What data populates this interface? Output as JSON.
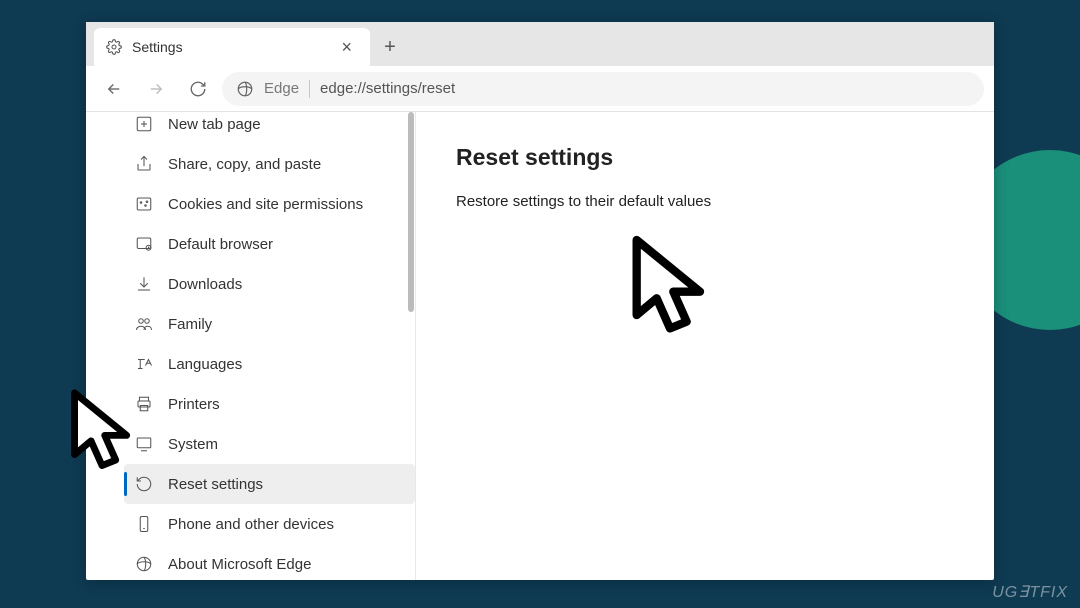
{
  "tab": {
    "title": "Settings"
  },
  "toolbar": {
    "edge_label": "Edge",
    "url": "edge://settings/reset"
  },
  "sidebar": {
    "items": [
      {
        "label": "New tab page",
        "icon": "newtab"
      },
      {
        "label": "Share, copy, and paste",
        "icon": "share"
      },
      {
        "label": "Cookies and site permissions",
        "icon": "cookies"
      },
      {
        "label": "Default browser",
        "icon": "defaultbrowser"
      },
      {
        "label": "Downloads",
        "icon": "downloads"
      },
      {
        "label": "Family",
        "icon": "family"
      },
      {
        "label": "Languages",
        "icon": "languages"
      },
      {
        "label": "Printers",
        "icon": "printers"
      },
      {
        "label": "System",
        "icon": "system"
      },
      {
        "label": "Reset settings",
        "icon": "reset",
        "active": true
      },
      {
        "label": "Phone and other devices",
        "icon": "phone"
      },
      {
        "label": "About Microsoft Edge",
        "icon": "edge"
      }
    ]
  },
  "main": {
    "heading": "Reset settings",
    "restore_link": "Restore settings to their default values"
  },
  "watermark": "UG∃TFIX"
}
